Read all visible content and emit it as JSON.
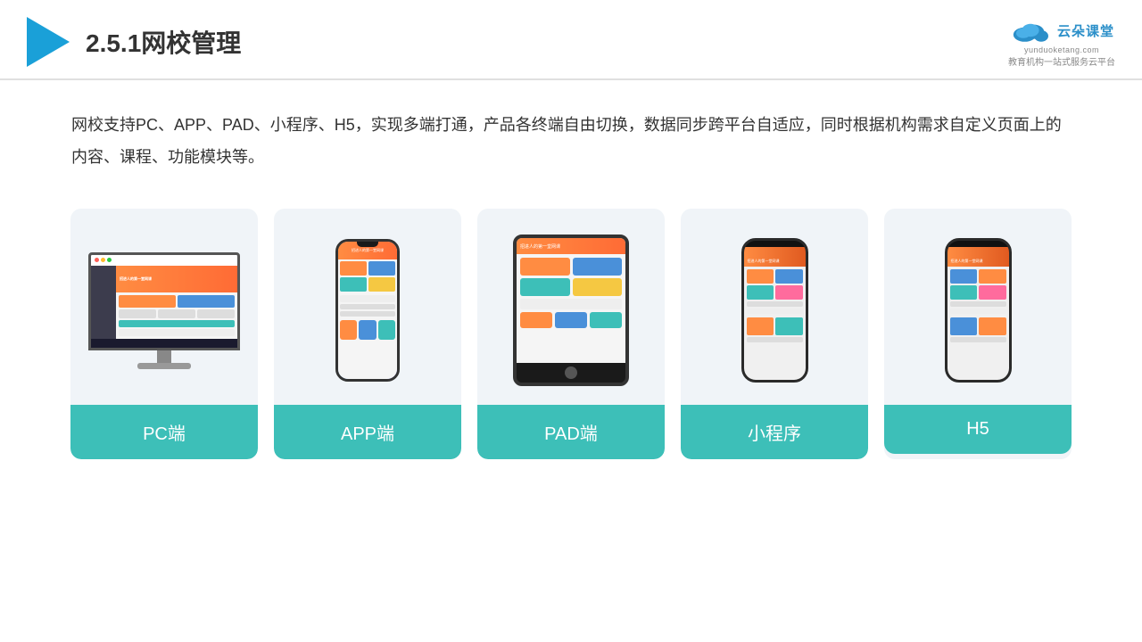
{
  "header": {
    "section": "2.5.1",
    "title": "网校管理",
    "logo_cn": "云朵课堂",
    "logo_en": "yunduoketang.com",
    "logo_tagline": "教育机构一站\n式服务云平台"
  },
  "description": {
    "text": "网校支持PC、APP、PAD、小程序、H5，实现多端打通，产品各终端自由切换，数据同步跨平台自适应，同时根据机构需求自定义页面上的内容、课程、功能模块等。"
  },
  "cards": [
    {
      "id": "pc",
      "label": "PC端"
    },
    {
      "id": "app",
      "label": "APP端"
    },
    {
      "id": "pad",
      "label": "PAD端"
    },
    {
      "id": "miniprogram",
      "label": "小程序"
    },
    {
      "id": "h5",
      "label": "H5"
    }
  ]
}
